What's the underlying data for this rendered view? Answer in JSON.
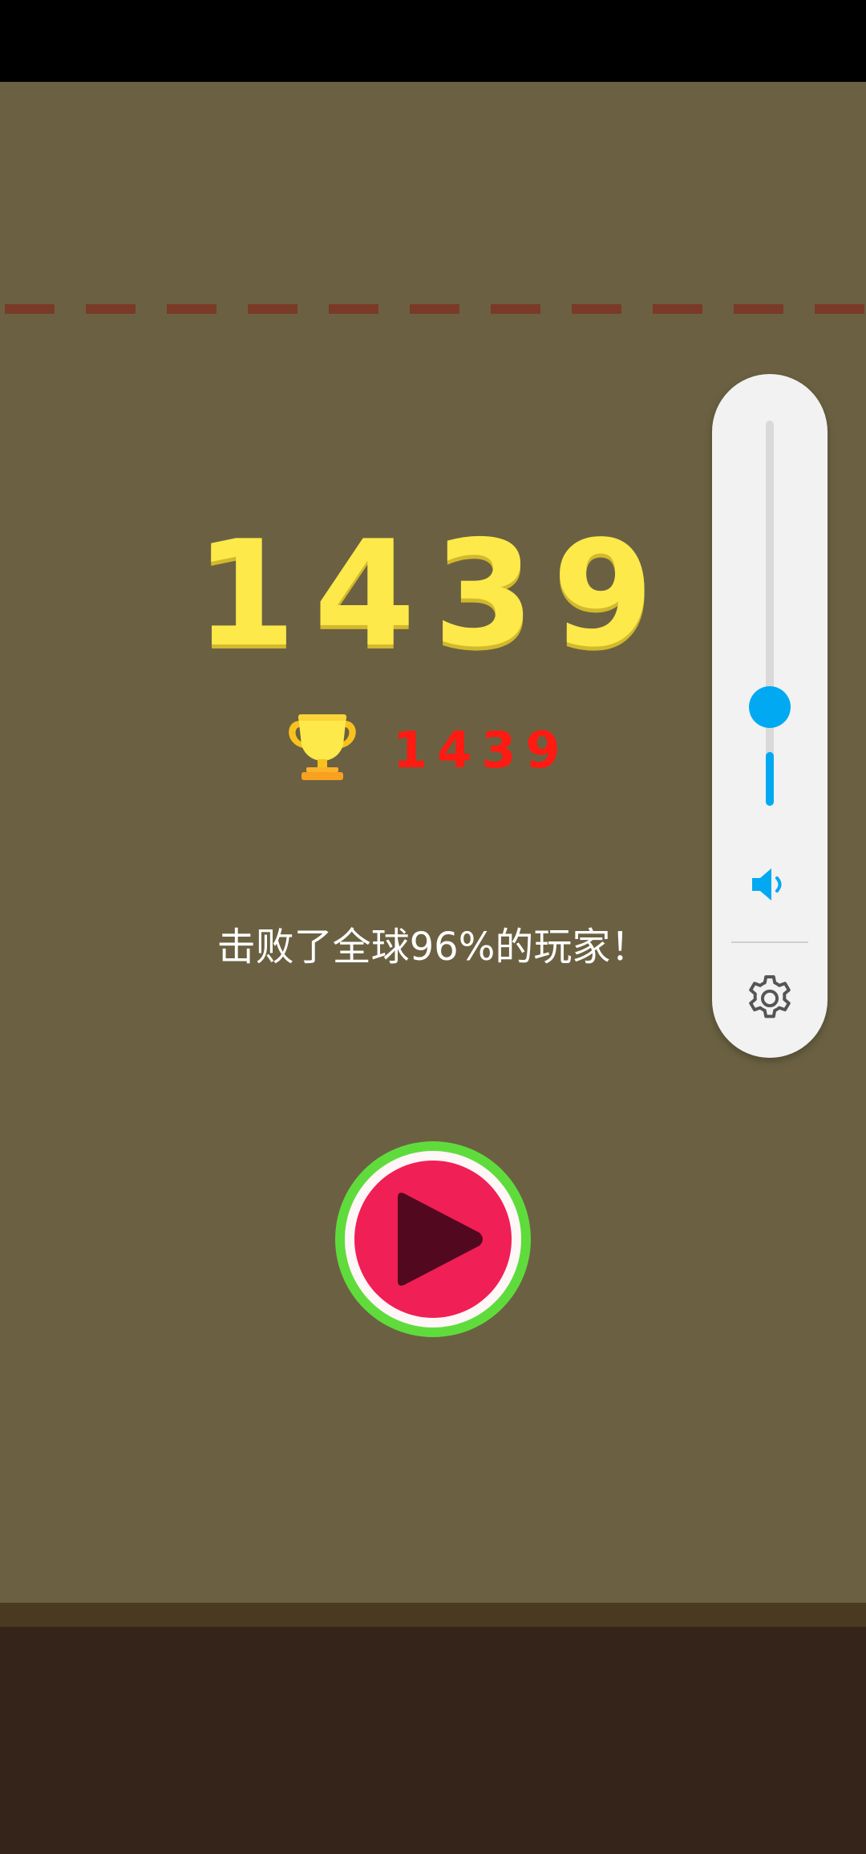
{
  "game": {
    "score": "1439",
    "best_score": "1439",
    "result_message": "击败了全球96%的玩家！"
  },
  "volume": {
    "level_percent": 14
  },
  "icons": {
    "trophy": "trophy-icon",
    "play": "play-icon",
    "speaker": "speaker-icon",
    "settings": "gear-icon"
  },
  "colors": {
    "background": "#6b6142",
    "ground": "#35241a",
    "danger_line": "#7a3a28",
    "score": "#fde94a",
    "best_score": "#ff1a12",
    "accent": "#00a9f1",
    "play_ring": "#5fdc3c",
    "play_fill": "#f01f55"
  }
}
